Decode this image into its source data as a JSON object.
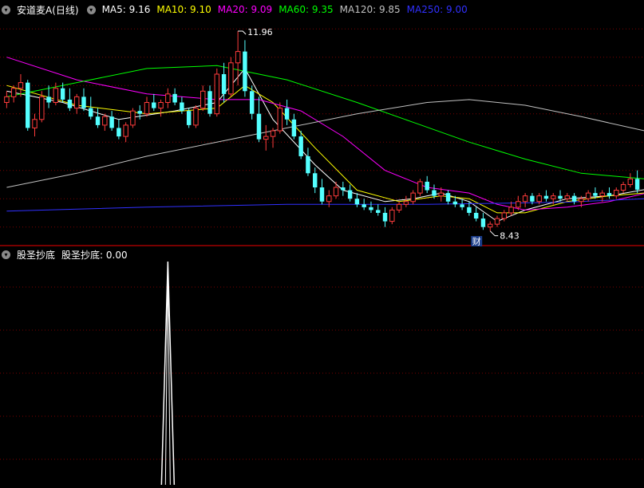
{
  "main_panel": {
    "stock_title": "安道麦A(日线)",
    "ma_legend": [
      {
        "label": "MA5: 9.16",
        "color": "#ffffff"
      },
      {
        "label": "MA10: 9.10",
        "color": "#ffff00"
      },
      {
        "label": "MA20: 9.09",
        "color": "#ff00ff"
      },
      {
        "label": "MA60: 9.35",
        "color": "#00ff00"
      },
      {
        "label": "MA120: 9.85",
        "color": "#c0c0c0"
      },
      {
        "label": "MA250: 9.00",
        "color": "#3030ff"
      }
    ],
    "high_label": "11.96",
    "low_label": "8.43",
    "marker_label": "财"
  },
  "sub_panel": {
    "title": "股圣抄底",
    "value_label": "股圣抄底: 0.00"
  },
  "colors": {
    "up": "#ff3c3c",
    "down": "#54ffff",
    "grid": "#7a0000",
    "divider": "#a00000"
  },
  "chart_data": [
    {
      "type": "candlestick",
      "ylim": [
        8.2,
        12.2
      ],
      "grid": true,
      "candles": [
        [
          10.7,
          10.9,
          10.6,
          10.8
        ],
        [
          10.8,
          11.0,
          10.7,
          10.95
        ],
        [
          10.95,
          11.2,
          10.8,
          11.05
        ],
        [
          11.05,
          11.1,
          10.2,
          10.25
        ],
        [
          10.25,
          10.5,
          10.1,
          10.4
        ],
        [
          10.4,
          10.9,
          10.35,
          10.8
        ],
        [
          10.8,
          11.0,
          10.6,
          10.7
        ],
        [
          10.7,
          11.05,
          10.65,
          10.95
        ],
        [
          10.95,
          11.05,
          10.7,
          10.75
        ],
        [
          10.75,
          10.95,
          10.55,
          10.6
        ],
        [
          10.6,
          10.85,
          10.5,
          10.8
        ],
        [
          10.8,
          10.95,
          10.55,
          10.6
        ],
        [
          10.6,
          10.8,
          10.4,
          10.45
        ],
        [
          10.45,
          10.6,
          10.25,
          10.3
        ],
        [
          10.3,
          10.5,
          10.2,
          10.45
        ],
        [
          10.45,
          10.55,
          10.2,
          10.25
        ],
        [
          10.25,
          10.4,
          10.05,
          10.1
        ],
        [
          10.1,
          10.35,
          10.0,
          10.3
        ],
        [
          10.3,
          10.6,
          10.25,
          10.55
        ],
        [
          10.55,
          10.65,
          10.4,
          10.5
        ],
        [
          10.5,
          10.8,
          10.45,
          10.7
        ],
        [
          10.7,
          10.85,
          10.55,
          10.6
        ],
        [
          10.6,
          10.75,
          10.45,
          10.7
        ],
        [
          10.7,
          10.95,
          10.6,
          10.85
        ],
        [
          10.85,
          10.95,
          10.65,
          10.7
        ],
        [
          10.7,
          10.8,
          10.5,
          10.55
        ],
        [
          10.55,
          10.6,
          10.25,
          10.3
        ],
        [
          10.3,
          10.65,
          10.25,
          10.6
        ],
        [
          10.6,
          11.0,
          10.55,
          10.9
        ],
        [
          10.9,
          11.0,
          10.45,
          10.5
        ],
        [
          10.5,
          11.3,
          10.45,
          11.2
        ],
        [
          11.2,
          11.4,
          10.7,
          10.85
        ],
        [
          10.85,
          11.5,
          10.8,
          11.4
        ],
        [
          11.4,
          11.96,
          11.0,
          11.6
        ],
        [
          11.6,
          11.8,
          10.8,
          10.9
        ],
        [
          10.9,
          11.0,
          10.4,
          10.5
        ],
        [
          10.5,
          10.8,
          10.0,
          10.05
        ],
        [
          10.05,
          10.3,
          9.85,
          10.1
        ],
        [
          10.1,
          10.25,
          9.9,
          10.2
        ],
        [
          10.2,
          10.7,
          10.15,
          10.6
        ],
        [
          10.6,
          10.75,
          10.3,
          10.4
        ],
        [
          10.4,
          10.5,
          10.05,
          10.1
        ],
        [
          10.1,
          10.2,
          9.7,
          9.75
        ],
        [
          9.75,
          9.9,
          9.4,
          9.45
        ],
        [
          9.45,
          9.55,
          9.1,
          9.2
        ],
        [
          9.2,
          9.35,
          8.9,
          8.95
        ],
        [
          8.95,
          9.15,
          8.85,
          9.05
        ],
        [
          9.05,
          9.3,
          9.0,
          9.2
        ],
        [
          9.2,
          9.3,
          9.05,
          9.15
        ],
        [
          9.15,
          9.25,
          8.95,
          9.0
        ],
        [
          9.0,
          9.1,
          8.85,
          8.9
        ],
        [
          8.9,
          9.0,
          8.8,
          8.85
        ],
        [
          8.85,
          8.95,
          8.75,
          8.8
        ],
        [
          8.8,
          8.9,
          8.7,
          8.75
        ],
        [
          8.75,
          8.85,
          8.5,
          8.6
        ],
        [
          8.6,
          8.85,
          8.55,
          8.8
        ],
        [
          8.8,
          8.95,
          8.75,
          8.9
        ],
        [
          8.9,
          9.05,
          8.85,
          8.95
        ],
        [
          8.95,
          9.15,
          8.9,
          9.1
        ],
        [
          9.1,
          9.35,
          9.05,
          9.3
        ],
        [
          9.3,
          9.4,
          9.1,
          9.15
        ],
        [
          9.15,
          9.25,
          9.0,
          9.05
        ],
        [
          9.05,
          9.2,
          8.95,
          9.1
        ],
        [
          9.1,
          9.15,
          8.9,
          8.95
        ],
        [
          8.95,
          9.05,
          8.85,
          8.9
        ],
        [
          8.9,
          9.0,
          8.8,
          8.85
        ],
        [
          8.85,
          8.95,
          8.7,
          8.75
        ],
        [
          8.75,
          8.85,
          8.6,
          8.65
        ],
        [
          8.65,
          8.75,
          8.45,
          8.5
        ],
        [
          8.5,
          8.6,
          8.43,
          8.55
        ],
        [
          8.55,
          8.7,
          8.5,
          8.65
        ],
        [
          8.65,
          8.8,
          8.6,
          8.75
        ],
        [
          8.75,
          8.95,
          8.7,
          8.85
        ],
        [
          8.85,
          9.05,
          8.8,
          8.95
        ],
        [
          8.95,
          9.1,
          8.85,
          9.05
        ],
        [
          9.05,
          9.1,
          8.9,
          8.95
        ],
        [
          8.95,
          9.1,
          8.9,
          9.05
        ],
        [
          9.05,
          9.15,
          8.95,
          9.0
        ],
        [
          9.0,
          9.1,
          8.9,
          9.05
        ],
        [
          9.05,
          9.15,
          8.95,
          9.0
        ],
        [
          9.0,
          9.1,
          8.95,
          9.05
        ],
        [
          9.05,
          9.1,
          8.9,
          8.95
        ],
        [
          8.95,
          9.05,
          8.85,
          9.0
        ],
        [
          9.0,
          9.15,
          8.95,
          9.1
        ],
        [
          9.1,
          9.2,
          9.0,
          9.05
        ],
        [
          9.05,
          9.15,
          8.95,
          9.1
        ],
        [
          9.1,
          9.2,
          9.0,
          9.05
        ],
        [
          9.05,
          9.2,
          9.0,
          9.15
        ],
        [
          9.15,
          9.3,
          9.1,
          9.25
        ],
        [
          9.25,
          9.45,
          9.2,
          9.35
        ],
        [
          9.35,
          9.5,
          9.1,
          9.16
        ]
      ],
      "ma_lines": [
        {
          "name": "MA5",
          "color": "#ffffff",
          "points": [
            [
              0,
              10.9
            ],
            [
              8,
              10.7
            ],
            [
              16,
              10.4
            ],
            [
              24,
              10.55
            ],
            [
              30,
              10.7
            ],
            [
              34,
              11.3
            ],
            [
              38,
              10.4
            ],
            [
              44,
              9.6
            ],
            [
              48,
              9.15
            ],
            [
              54,
              8.95
            ],
            [
              58,
              9.0
            ],
            [
              62,
              9.1
            ],
            [
              66,
              8.95
            ],
            [
              70,
              8.6
            ],
            [
              74,
              8.8
            ],
            [
              80,
              9.0
            ],
            [
              86,
              9.05
            ],
            [
              91,
              9.16
            ]
          ]
        },
        {
          "name": "MA10",
          "color": "#ffff00",
          "points": [
            [
              0,
              11.0
            ],
            [
              10,
              10.65
            ],
            [
              20,
              10.5
            ],
            [
              30,
              10.6
            ],
            [
              34,
              11.0
            ],
            [
              38,
              10.7
            ],
            [
              44,
              9.9
            ],
            [
              50,
              9.15
            ],
            [
              56,
              8.95
            ],
            [
              62,
              9.05
            ],
            [
              66,
              9.0
            ],
            [
              70,
              8.75
            ],
            [
              74,
              8.75
            ],
            [
              80,
              8.95
            ],
            [
              86,
              9.05
            ],
            [
              91,
              9.1
            ]
          ]
        },
        {
          "name": "MA20",
          "color": "#ff00ff",
          "points": [
            [
              0,
              11.5
            ],
            [
              10,
              11.1
            ],
            [
              20,
              10.85
            ],
            [
              30,
              10.75
            ],
            [
              36,
              10.75
            ],
            [
              42,
              10.55
            ],
            [
              48,
              10.1
            ],
            [
              54,
              9.5
            ],
            [
              60,
              9.2
            ],
            [
              66,
              9.1
            ],
            [
              70,
              8.9
            ],
            [
              74,
              8.8
            ],
            [
              80,
              8.85
            ],
            [
              86,
              8.95
            ],
            [
              91,
              9.09
            ]
          ]
        },
        {
          "name": "MA60",
          "color": "#00ff00",
          "points": [
            [
              0,
              10.8
            ],
            [
              10,
              11.05
            ],
            [
              20,
              11.3
            ],
            [
              30,
              11.35
            ],
            [
              40,
              11.1
            ],
            [
              50,
              10.7
            ],
            [
              58,
              10.35
            ],
            [
              66,
              10.0
            ],
            [
              74,
              9.7
            ],
            [
              82,
              9.45
            ],
            [
              91,
              9.35
            ]
          ]
        },
        {
          "name": "MA120",
          "color": "#c0c0c0",
          "points": [
            [
              0,
              9.2
            ],
            [
              10,
              9.45
            ],
            [
              20,
              9.75
            ],
            [
              30,
              10.0
            ],
            [
              40,
              10.25
            ],
            [
              50,
              10.5
            ],
            [
              60,
              10.7
            ],
            [
              66,
              10.75
            ],
            [
              74,
              10.65
            ],
            [
              82,
              10.45
            ],
            [
              91,
              10.2
            ]
          ]
        },
        {
          "name": "MA250",
          "color": "#3030ff",
          "points": [
            [
              0,
              8.78
            ],
            [
              20,
              8.85
            ],
            [
              40,
              8.9
            ],
            [
              60,
              8.9
            ],
            [
              80,
              8.94
            ],
            [
              91,
              9.0
            ]
          ]
        }
      ]
    },
    {
      "type": "line",
      "ylim": [
        0,
        1
      ],
      "spike_index": 23,
      "values_nonzero": [
        [
          23,
          1
        ]
      ]
    }
  ]
}
